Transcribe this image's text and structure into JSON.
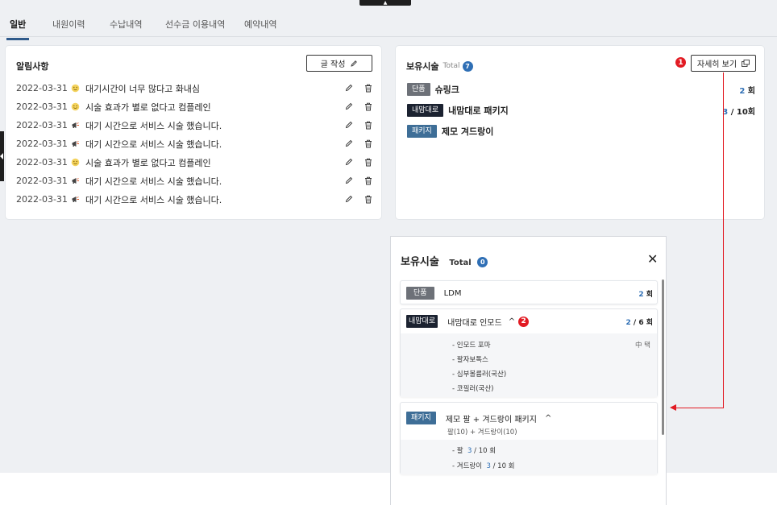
{
  "tabs": [
    "일반",
    "내원이력",
    "수납내역",
    "선수금 이용내역",
    "예약내역"
  ],
  "notice": {
    "title": "알림사항",
    "write_label": "글 작성",
    "rows": [
      {
        "date": "2022-03-31",
        "icon": "smile-icon",
        "text": "대기시간이 너무 많다고 화내심"
      },
      {
        "date": "2022-03-31",
        "icon": "smile-icon",
        "text": "시술 효과가 별로 없다고 컴플레인"
      },
      {
        "date": "2022-03-31",
        "icon": "megaphone-icon",
        "text": "대기 시간으로 서비스 시술 했습니다."
      },
      {
        "date": "2022-03-31",
        "icon": "megaphone-icon",
        "text": "대기 시간으로 서비스 시술 했습니다."
      },
      {
        "date": "2022-03-31",
        "icon": "smile-icon",
        "text": "시술 효과가 별로 없다고 컴플레인"
      },
      {
        "date": "2022-03-31",
        "icon": "megaphone-icon",
        "text": "대기 시간으로 서비스 시술 했습니다."
      },
      {
        "date": "2022-03-31",
        "icon": "megaphone-icon",
        "text": "대기 시간으로 서비스 시술 했습니다."
      }
    ]
  },
  "owned": {
    "title": "보유시술",
    "total_label": "Total",
    "total_count": "7",
    "detail_label": "자세히 보기",
    "items": [
      {
        "badge": "단품",
        "name": "슈링크",
        "count_num": "2",
        "count_rest": " 회"
      },
      {
        "badge": "내맘대로",
        "name": "내맘대로 패키지",
        "count_num": "3",
        "count_rest": " / 10회"
      },
      {
        "badge": "패키지",
        "name": "제모 겨드랑이",
        "count_num": "",
        "count_rest": ""
      }
    ]
  },
  "markers": [
    "1",
    "2"
  ],
  "popup": {
    "title": "보유시술",
    "total_label": "Total",
    "total_count": "0",
    "items": [
      {
        "badge": "단품",
        "name": "LDM",
        "count_num": "2",
        "count_rest": " 회"
      },
      {
        "badge": "내맘대로",
        "name": "내맘대로 인모드",
        "caret": "^",
        "count_num": "2",
        "count_rest": " / 6 회",
        "subs": [
          "- 인모드 포마",
          "- 팔자보톡스",
          "- 심부볼륨러(국산)",
          "- 코필러(국산)"
        ],
        "sub_right": "中 택"
      },
      {
        "badge": "패키지",
        "name": "제모 팔 + 겨드랑이 패키지",
        "caret": "^",
        "desc": "팔(10) + 겨드랑이(10)",
        "subs": [
          {
            "label": "- 팔",
            "num": "3",
            "rest": " / 10 회"
          },
          {
            "label": "- 겨드랑이",
            "num": "3",
            "rest": " / 10 회"
          }
        ]
      }
    ]
  },
  "colors": {
    "accent": "#2f5a8b",
    "badge_single": "#6d7178",
    "badge_large": "#1b2230",
    "badge_package": "#3e6e97",
    "marker": "#e21b23",
    "link_blue": "#2f6fb5"
  }
}
